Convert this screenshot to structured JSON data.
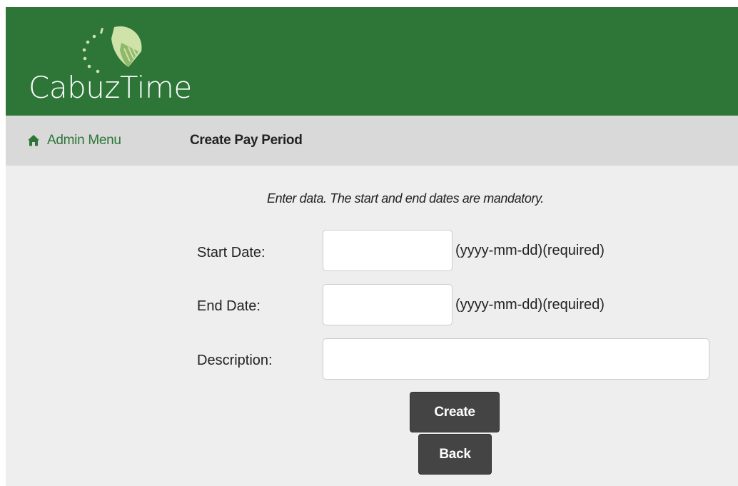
{
  "app": {
    "brand_name": "CabuzTime"
  },
  "nav": {
    "home_icon": "home-icon",
    "home_label": "Admin Menu",
    "current_page": "Create Pay Period"
  },
  "form": {
    "instruction": "Enter data. The start and end dates are mandatory.",
    "start_date": {
      "label": "Start Date:",
      "value": "",
      "hint": "(yyyy-mm-dd)(required)"
    },
    "end_date": {
      "label": "End Date:",
      "value": "",
      "hint": "(yyyy-mm-dd)(required)"
    },
    "description": {
      "label": "Description:",
      "value": ""
    },
    "create_label": "Create",
    "back_label": "Back"
  },
  "colors": {
    "header_green": "#2d7637",
    "nav_gray": "#d9d9d9",
    "body_gray": "#eeeeee",
    "logo_light_green": "#cfe2a8",
    "button_dark": "#444444"
  }
}
